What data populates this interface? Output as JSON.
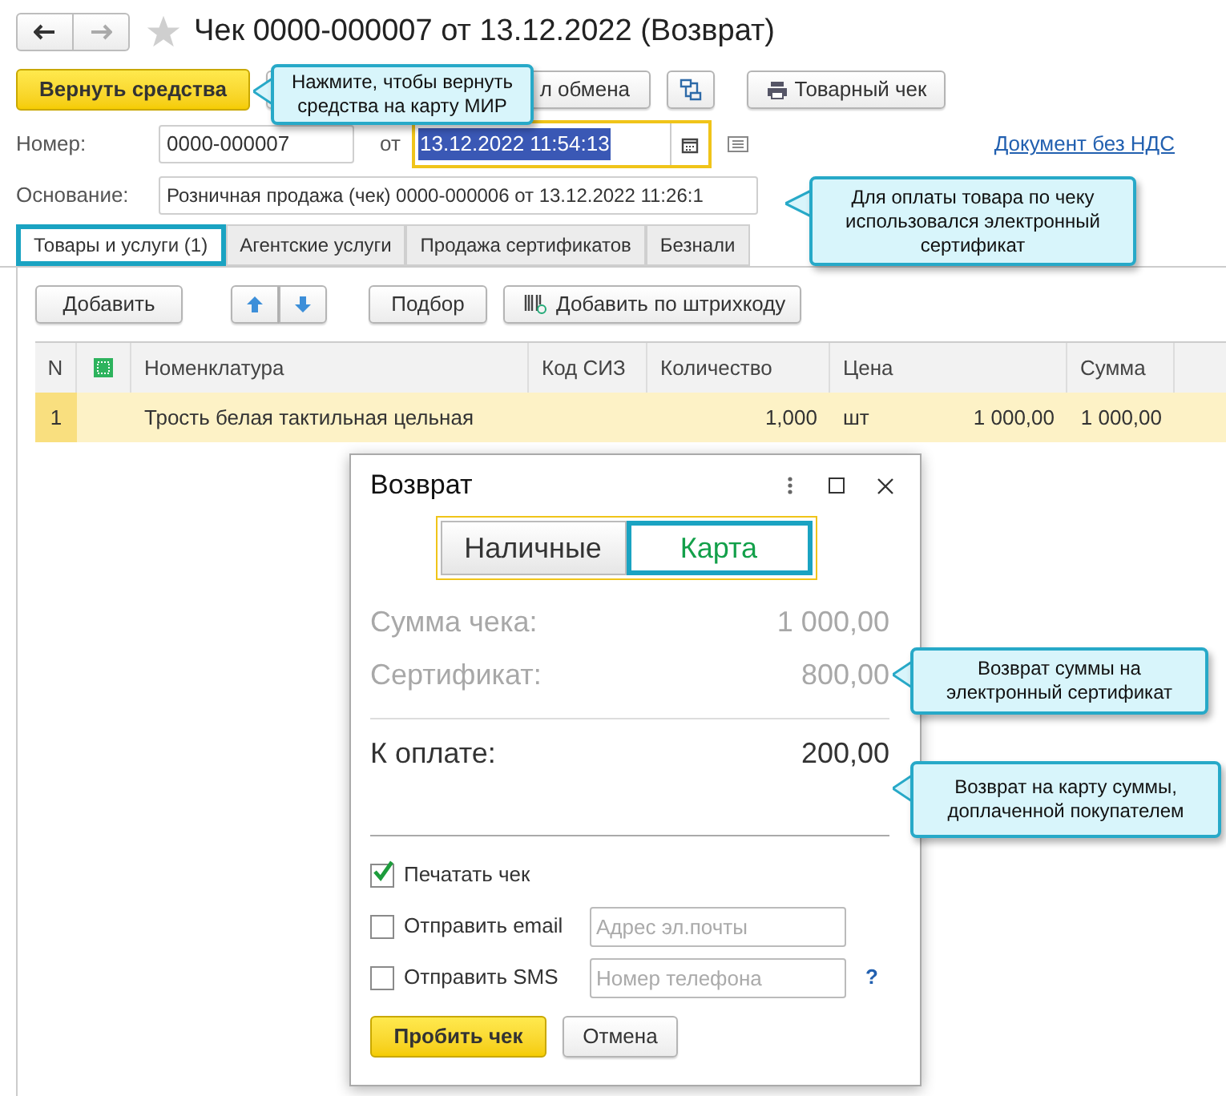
{
  "window": {
    "title": "Чек 0000-000007 от 13.12.2022 (Возврат)",
    "favorite": false
  },
  "toolbar": [
    {
      "kind": "primary",
      "label": "Вернуть средства"
    },
    {
      "kind": "plain",
      "label": "л обмена"
    },
    {
      "kind": "icon"
    },
    {
      "kind": "print",
      "label": "Товарный чек"
    }
  ],
  "number": {
    "label": "Номер:",
    "value": "0000-000007"
  },
  "date": {
    "label": "от",
    "value": "13.12.2022 11:54:13"
  },
  "link": "Документ без НДС",
  "basis": {
    "label": "Основание:",
    "value": "Розничная продажа (чек) 0000-000006 от 13.12.2022 11:26:1"
  },
  "tabs": [
    {
      "label": "Товары и услуги (1)",
      "selected": true,
      "highlighted": true
    },
    {
      "label": "Агентские услуги",
      "selected": false,
      "highlighted": false
    },
    {
      "label": "Продажа сертификатов",
      "selected": false,
      "highlighted": false
    },
    {
      "label": "Безнали",
      "selected": false,
      "highlighted": false
    }
  ],
  "table_toolbar": {
    "add": "Добавить",
    "pick": "Подбор",
    "barcode": "Добавить по штрихкоду"
  },
  "table": {
    "columns": [
      "N",
      "Номенклатура",
      "Код СИЗ",
      "Количество",
      "Цена",
      "Сумма"
    ],
    "rows": [
      {
        "n": "1",
        "name": "Трость белая тактильная цельная",
        "quantity": "1,000",
        "unit": "шт",
        "price": "1 000,00",
        "sum": "1 000,00",
        "selected": true
      }
    ]
  },
  "dialog": {
    "title": "Возврат",
    "modes": [
      {
        "label": "Наличные",
        "selected": false,
        "highlighted": false
      },
      {
        "label": "Карта",
        "selected": true,
        "highlighted": true
      }
    ],
    "lines": [
      {
        "label": "Сумма чека:",
        "value": "1 000,00"
      },
      {
        "label": "Сертификат:",
        "value": "800,00"
      }
    ],
    "total": {
      "label": "К оплате:",
      "value": "200,00"
    },
    "options": [
      {
        "label": "Печатать чек",
        "checked": true
      },
      {
        "label": "Отправить email",
        "checked": false,
        "placeholder": "Адрес эл.почты"
      },
      {
        "label": "Отправить SMS",
        "checked": false,
        "placeholder": "Номер телефона",
        "help": "?"
      }
    ],
    "buttons": [
      {
        "kind": "primary",
        "label": "Пробить чек"
      },
      {
        "kind": "plain",
        "label": "Отмена"
      }
    ]
  },
  "callouts": [
    "Нажмите, чтобы вернуть средства на карту МИР",
    "Для оплаты товара по чеку использовался электронный сертификат",
    "Возврат суммы на электронный сертификат",
    "Возврат на карту суммы, доплаченной покупателем"
  ]
}
